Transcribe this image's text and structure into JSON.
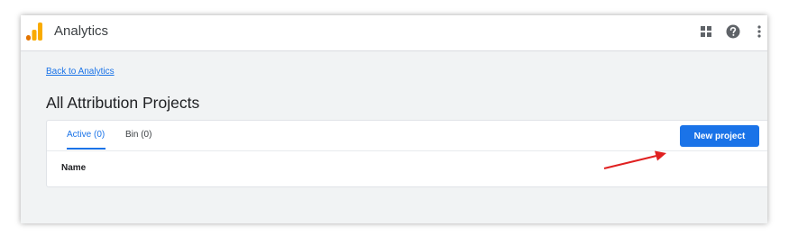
{
  "app": {
    "title": "Analytics",
    "logo_icon": "analytics-bars-logo",
    "logo_colors": [
      "#f9ab00",
      "#e37400"
    ]
  },
  "header_icons": [
    "apps-grid-icon",
    "help-icon",
    "more-vert-icon"
  ],
  "breadcrumb": {
    "back_label": "Back to Analytics"
  },
  "page": {
    "title": "All Attribution Projects"
  },
  "tabs": [
    {
      "label": "Active (0)",
      "active": true
    },
    {
      "label": "Bin (0)",
      "active": false
    }
  ],
  "toolbar": {
    "new_project_label": "New project"
  },
  "table": {
    "columns": [
      "Name"
    ],
    "rows": []
  },
  "colors": {
    "accent": "#1a73e8",
    "annotation_arrow": "#e02020"
  }
}
